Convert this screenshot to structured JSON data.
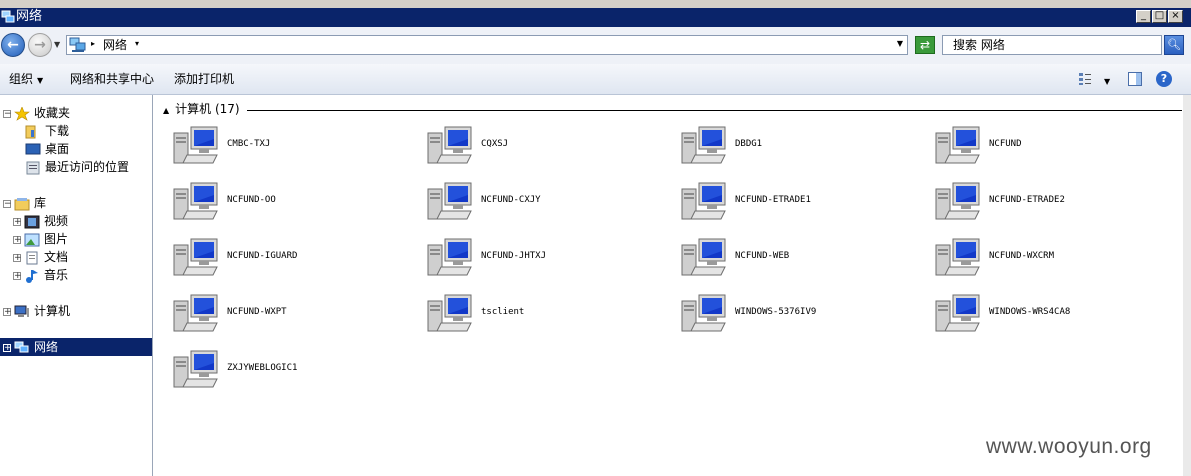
{
  "window": {
    "title": "网络"
  },
  "address": {
    "location": "网络",
    "search_placeholder": "搜索 网络"
  },
  "toolbar": {
    "organize": "组织",
    "network_center": "网络和共享中心",
    "add_printer": "添加打印机"
  },
  "nav": {
    "favorites": "收藏夹",
    "downloads": "下载",
    "desktop": "桌面",
    "recent": "最近访问的位置",
    "libraries": "库",
    "videos": "视频",
    "pictures": "图片",
    "documents": "文档",
    "music": "音乐",
    "computer": "计算机",
    "network": "网络"
  },
  "group": {
    "header": "计算机 (17)"
  },
  "computers": [
    "CMBC-TXJ",
    "CQXSJ",
    "DBDG1",
    "NCFUND",
    "NCFUND-OO",
    "NCFUND-CXJY",
    "NCFUND-ETRADE1",
    "NCFUND-ETRADE2",
    "NCFUND-IGUARD",
    "NCFUND-JHTXJ",
    "NCFUND-WEB",
    "NCFUND-WXCRM",
    "NCFUND-WXPT",
    "tsclient",
    "WINDOWS-5376IV9",
    "WINDOWS-WRS4CA8",
    "ZXJYWEBLOGIC1"
  ],
  "watermark": "www.wooyun.org",
  "colors": {
    "title_bar": "#0a246a",
    "selection": "#0a246a"
  }
}
